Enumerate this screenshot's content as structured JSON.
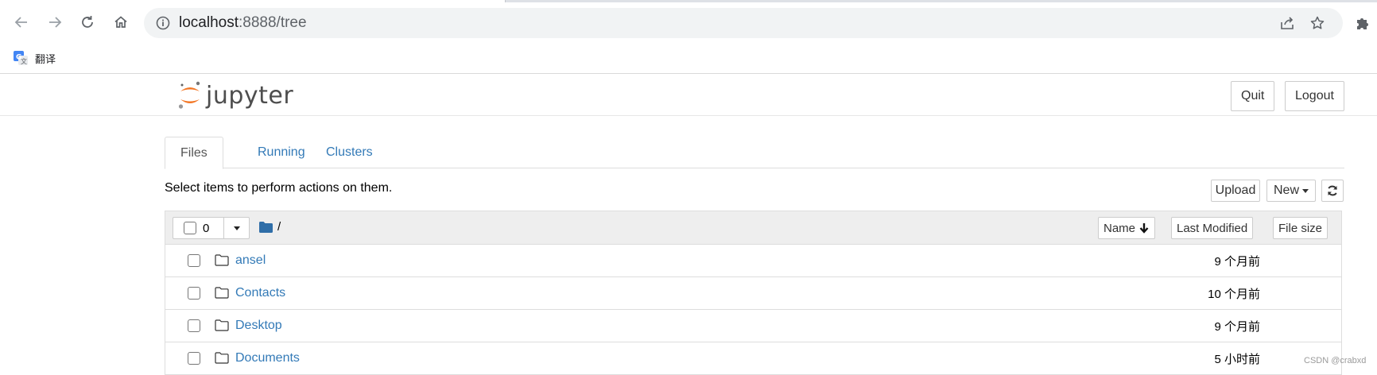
{
  "browser": {
    "url_host": "localhost",
    "url_rest": ":8888/tree",
    "bookmark_label": "翻译"
  },
  "jupyter": {
    "logo_text": "jupyter",
    "quit_label": "Quit",
    "logout_label": "Logout",
    "tabs": [
      {
        "label": "Files"
      },
      {
        "label": "Running"
      },
      {
        "label": "Clusters"
      }
    ],
    "instructions": "Select items to perform actions on them.",
    "upload_label": "Upload",
    "new_label": "New",
    "selected_count": "0",
    "breadcrumb_root": "/",
    "columns": {
      "name": "Name",
      "last_modified": "Last Modified",
      "file_size": "File size"
    },
    "files": [
      {
        "name": "ansel",
        "modified": "9 个月前"
      },
      {
        "name": "Contacts",
        "modified": "10 个月前"
      },
      {
        "name": "Desktop",
        "modified": "9 个月前"
      },
      {
        "name": "Documents",
        "modified": "5 小时前"
      }
    ]
  },
  "watermark": "CSDN @crabxd",
  "colors": {
    "link": "#337ab7",
    "jupyter_orange": "#f37726",
    "folder_blue": "#2f6ea8"
  }
}
